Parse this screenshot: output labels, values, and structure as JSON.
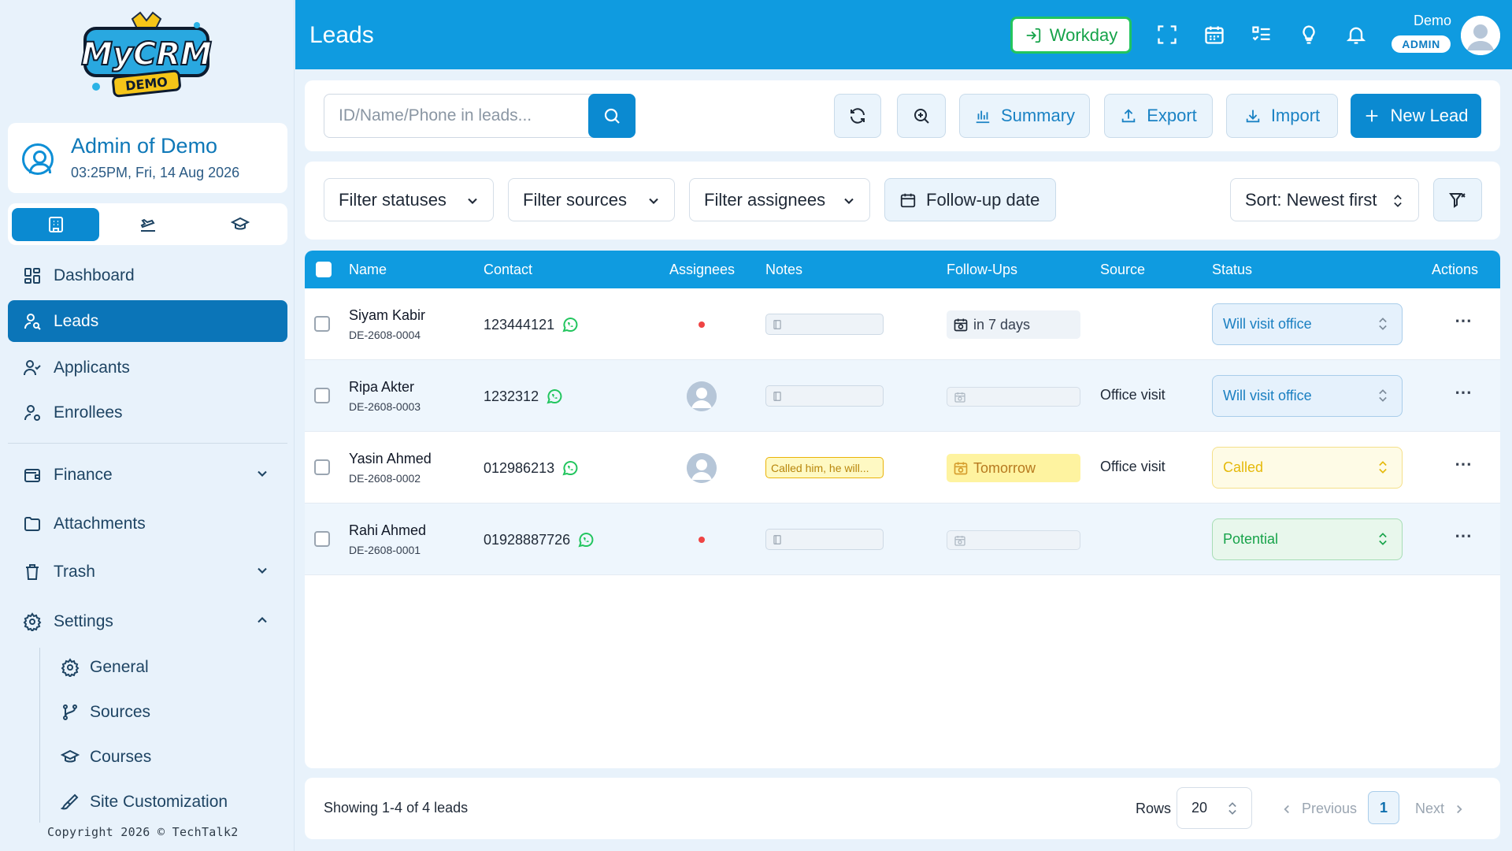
{
  "brand": {
    "logo_text": "MyCRM",
    "logo_sub": "DEMO"
  },
  "profile": {
    "name": "Admin of Demo",
    "datetime": "03:25PM, Fri, 14 Aug 2026"
  },
  "mode_tabs": [
    {
      "icon": "building-icon",
      "active": true
    },
    {
      "icon": "plane-icon",
      "active": false
    },
    {
      "icon": "graduation-cap-icon",
      "active": false
    }
  ],
  "nav": {
    "dashboard": "Dashboard",
    "leads": "Leads",
    "applicants": "Applicants",
    "enrollees": "Enrollees",
    "finance": "Finance",
    "attachments": "Attachments",
    "trash": "Trash",
    "settings": "Settings",
    "settings_sub": {
      "general": "General",
      "sources": "Sources",
      "courses": "Courses",
      "site_customization": "Site Customization"
    }
  },
  "copyright": "Copyright 2026 © TechTalk2",
  "header": {
    "title": "Leads",
    "workday_label": "Workday",
    "user_name": "Demo",
    "user_role": "ADMIN"
  },
  "toolbar": {
    "search_placeholder": "ID/Name/Phone in leads...",
    "summary": "Summary",
    "export": "Export",
    "import": "Import",
    "new_lead": "New Lead"
  },
  "filters": {
    "statuses": "Filter statuses",
    "sources": "Filter sources",
    "assignees": "Filter assignees",
    "followup": "Follow-up date",
    "sort": "Sort: Newest first"
  },
  "table": {
    "columns": {
      "name": "Name",
      "contact": "Contact",
      "assignees": "Assignees",
      "notes": "Notes",
      "followups": "Follow-Ups",
      "source": "Source",
      "status": "Status",
      "actions": "Actions"
    },
    "rows": [
      {
        "name": "Siyam Kabir",
        "id": "DE-2608-0004",
        "contact": "123444121",
        "assignee": "none",
        "note": "",
        "followup": "in 7 days",
        "source": "",
        "status": "Will visit office"
      },
      {
        "name": "Ripa Akter",
        "id": "DE-2608-0003",
        "contact": "1232312",
        "assignee": "avatar",
        "note": "",
        "followup": "",
        "source": "Office visit",
        "status": "Will visit office"
      },
      {
        "name": "Yasin Ahmed",
        "id": "DE-2608-0002",
        "contact": "012986213",
        "assignee": "avatar",
        "note": "Called him, he will...",
        "followup": "Tomorrow",
        "source": "Office visit",
        "status": "Called"
      },
      {
        "name": "Rahi Ahmed",
        "id": "DE-2608-0001",
        "contact": "01928887726",
        "assignee": "none",
        "note": "",
        "followup": "",
        "source": "",
        "status": "Potential"
      }
    ],
    "actions_glyph": "⋯"
  },
  "footer": {
    "showing": "Showing 1-4 of 4 leads",
    "rows_label": "Rows",
    "rows_value": "20",
    "previous": "Previous",
    "page": "1",
    "next": "Next"
  },
  "colors": {
    "primary": "#0f9be0",
    "active_nav": "#0b75b8",
    "workday_green": "#22c55e",
    "danger_dot": "#ef4444"
  }
}
